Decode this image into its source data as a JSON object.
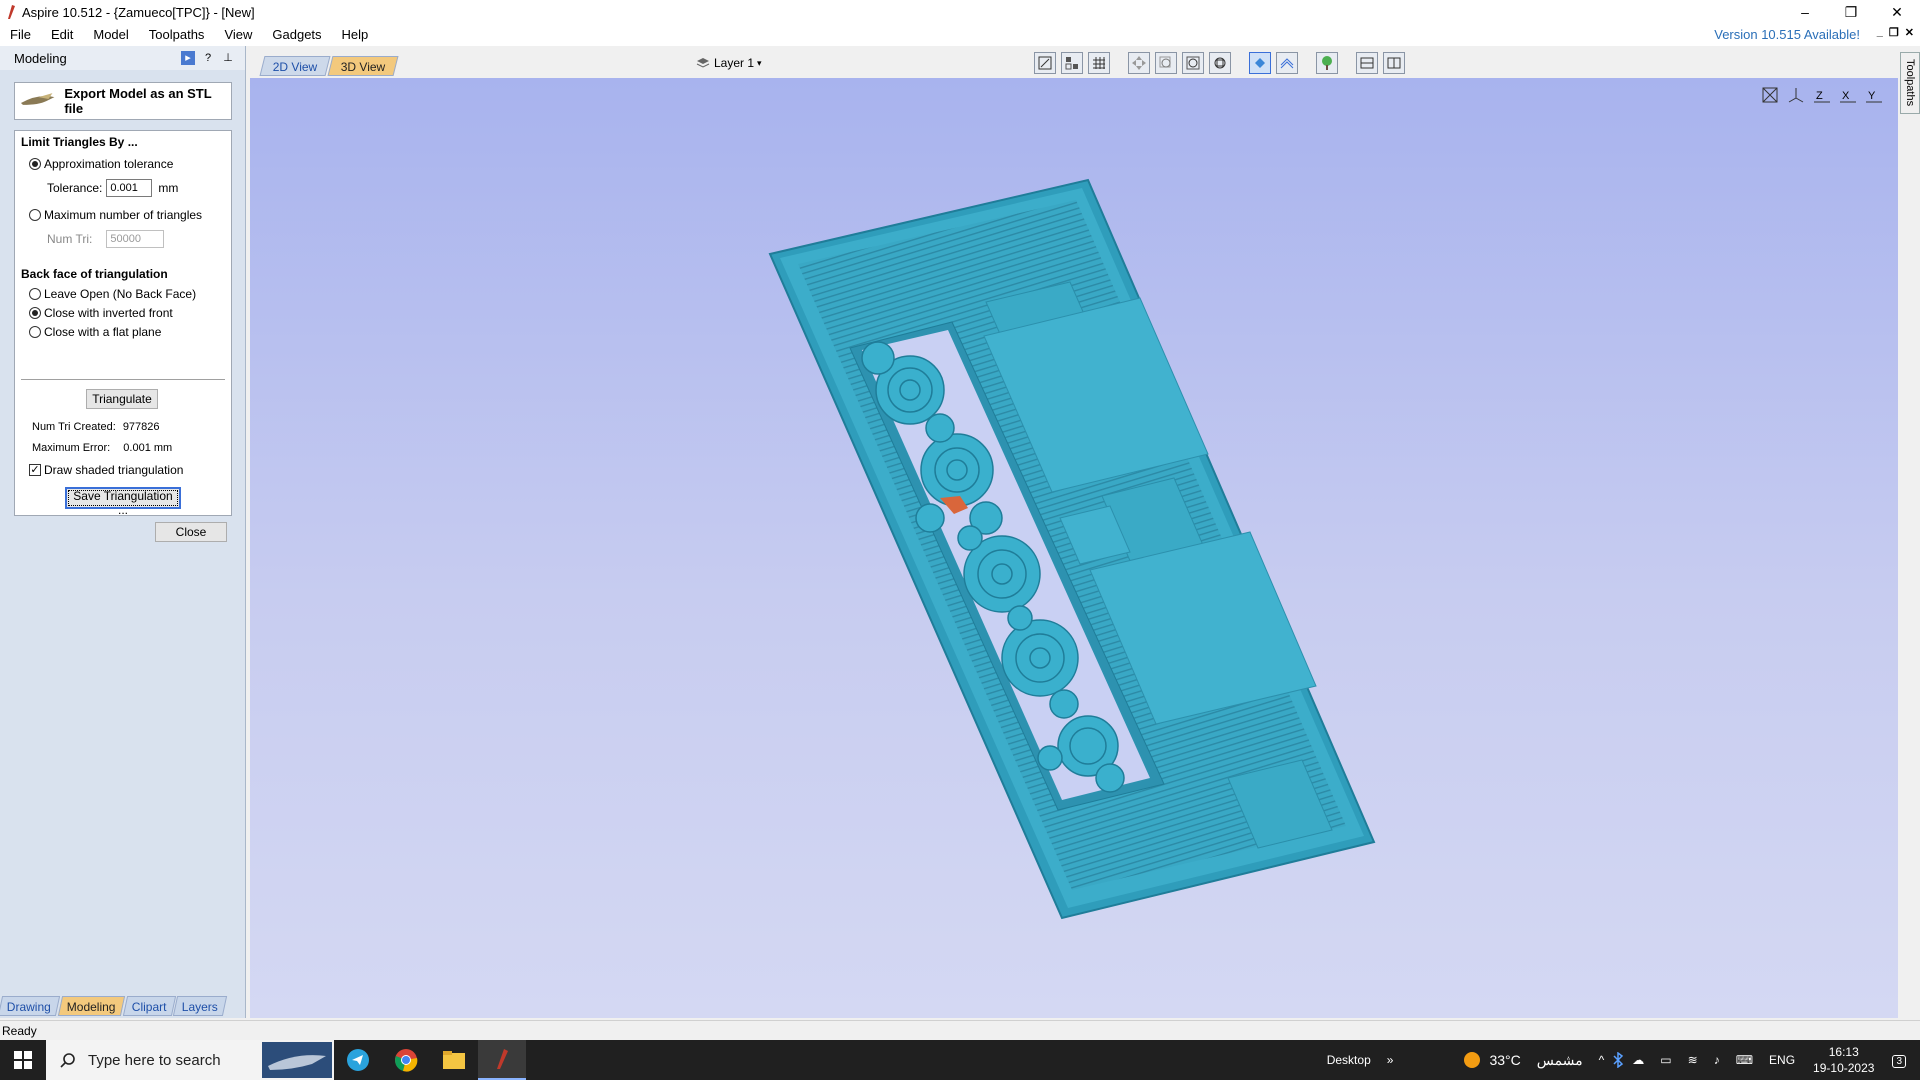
{
  "window": {
    "title": "Aspire 10.512 - {Zamueco[TPC]} - [New]",
    "minimize": "–",
    "maximize": "❐",
    "close": "✕"
  },
  "menu": {
    "items": [
      "File",
      "Edit",
      "Model",
      "Toolpaths",
      "View",
      "Gadgets",
      "Help"
    ],
    "version_notice": "Version 10.515 Available!"
  },
  "left_panel": {
    "header": "Modeling",
    "export_title": "Export Model as an STL file",
    "limit_heading": "Limit Triangles By ...",
    "approx_label": "Approximation tolerance",
    "tolerance_label": "Tolerance:",
    "tolerance_value": "0.001",
    "tolerance_unit": "mm",
    "max_tri_label": "Maximum number of triangles",
    "num_tri_label": "Num Tri:",
    "num_tri_value": "50000",
    "backface_heading": "Back face of triangulation",
    "leave_open_label": "Leave Open (No Back Face)",
    "close_inverted_label": "Close with inverted front",
    "close_flat_label": "Close with a flat plane",
    "triangulate_label": "Triangulate",
    "num_created_label": "Num Tri Created:",
    "num_created_value": "977826",
    "max_error_label": "Maximum Error:",
    "max_error_value": "0.001 mm",
    "draw_shaded_label": "Draw shaded triangulation",
    "save_label": "Save Triangulation ...",
    "close_label": "Close",
    "tabs": [
      "Drawing",
      "Modeling",
      "Clipart",
      "Layers"
    ]
  },
  "view": {
    "tab_2d": "2D View",
    "tab_3d": "3D View",
    "layer": "Layer 1",
    "side_tab": "Toolpaths"
  },
  "status": {
    "text": "Ready"
  },
  "taskbar": {
    "search_placeholder": "Type here to search",
    "desktop": "Desktop",
    "weather": "33°C",
    "weather_text": "مشمس",
    "lang": "ENG",
    "time": "16:13",
    "date": "19-10-2023",
    "notification_count": "3"
  },
  "colors": {
    "model": "#3aa9c6",
    "highlight": "#d9663b",
    "viewport_top": "#a8b3ee",
    "accent_tab": "#f3c97d"
  }
}
